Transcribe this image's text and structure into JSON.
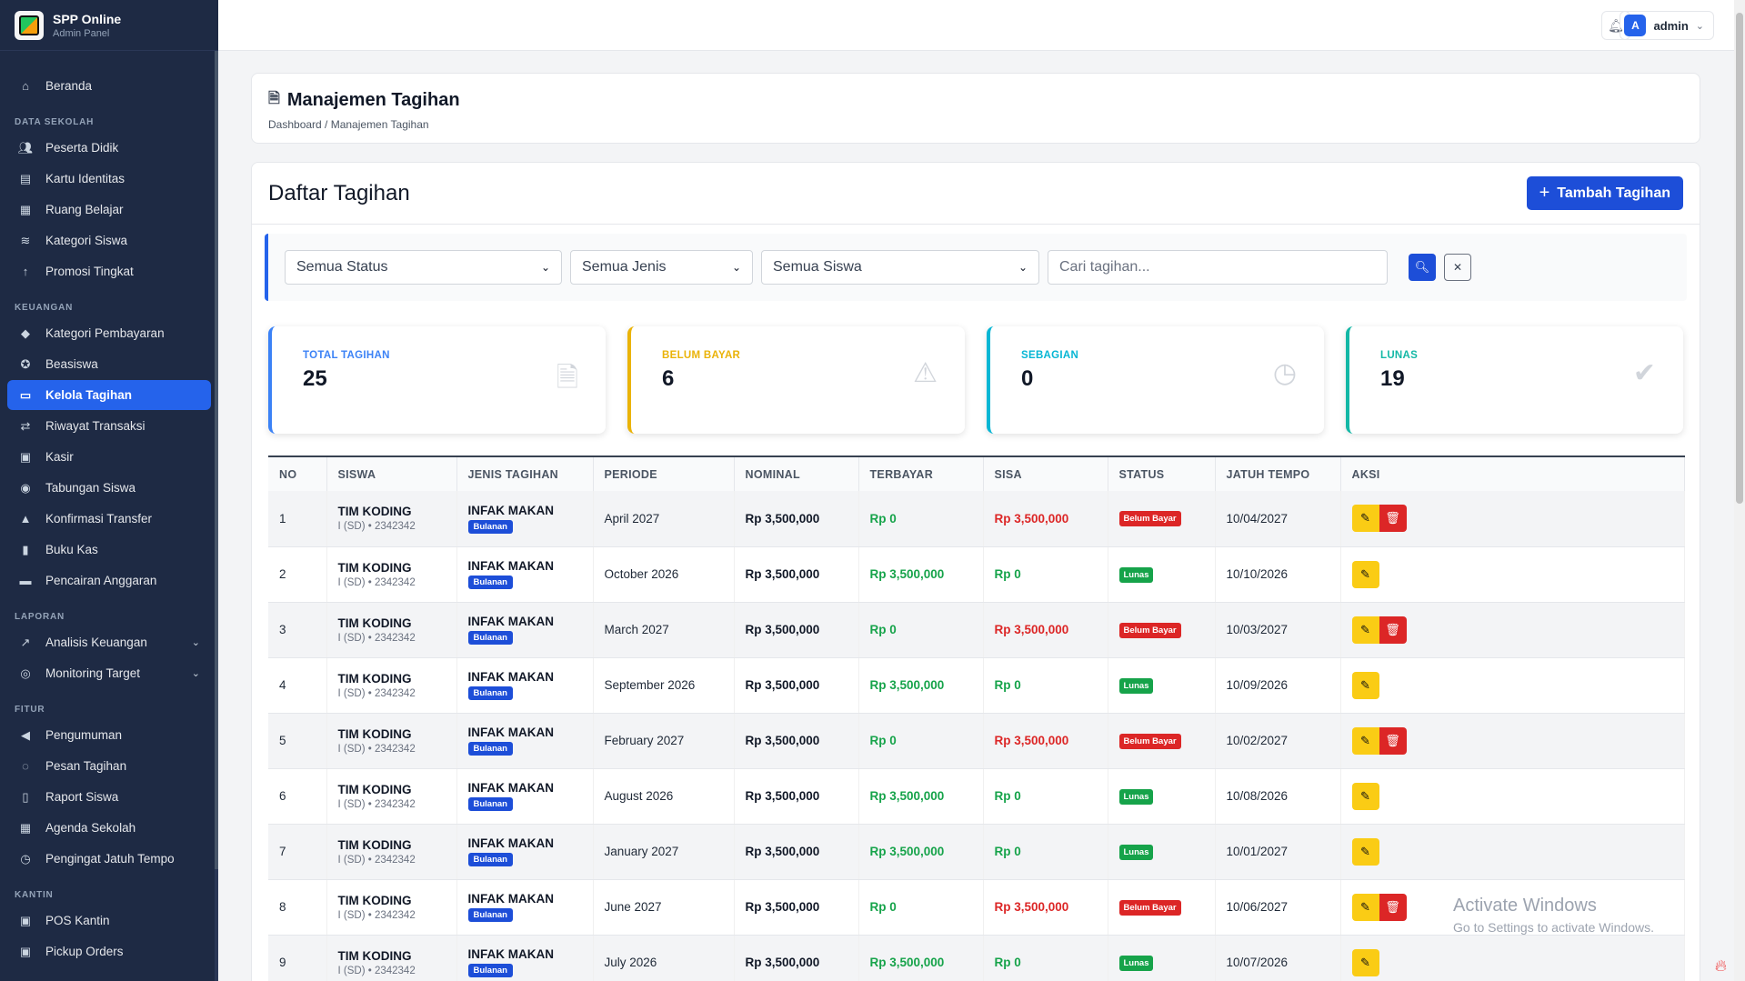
{
  "brand": {
    "title": "SPP Online",
    "subtitle": "Admin Panel"
  },
  "sidebar": {
    "home": {
      "label": "Beranda",
      "icon": "home-icon"
    },
    "sections": [
      {
        "title": "DATA SEKOLAH",
        "items": [
          {
            "label": "Peserta Didik",
            "icon": "users-icon"
          },
          {
            "label": "Kartu Identitas",
            "icon": "id-card-icon"
          },
          {
            "label": "Ruang Belajar",
            "icon": "building-icon"
          },
          {
            "label": "Kategori Siswa",
            "icon": "layers-icon"
          },
          {
            "label": "Promosi Tingkat",
            "icon": "arrow-up-icon"
          }
        ]
      },
      {
        "title": "KEUANGAN",
        "items": [
          {
            "label": "Kategori Pembayaran",
            "icon": "tag-icon"
          },
          {
            "label": "Beasiswa",
            "icon": "award-icon"
          },
          {
            "label": "Kelola Tagihan",
            "icon": "file-invoice-icon",
            "active": true
          },
          {
            "label": "Riwayat Transaksi",
            "icon": "exchange-icon"
          },
          {
            "label": "Kasir",
            "icon": "cash-register-icon"
          },
          {
            "label": "Tabungan Siswa",
            "icon": "piggy-bank-icon"
          },
          {
            "label": "Konfirmasi Transfer",
            "icon": "bell-icon"
          },
          {
            "label": "Buku Kas",
            "icon": "book-icon"
          },
          {
            "label": "Pencairan Anggaran",
            "icon": "wallet-icon"
          }
        ]
      },
      {
        "title": "LAPORAN",
        "items": [
          {
            "label": "Analisis Keuangan",
            "icon": "chart-line-icon",
            "expandable": true
          },
          {
            "label": "Monitoring Target",
            "icon": "target-icon",
            "expandable": true
          }
        ]
      },
      {
        "title": "FITUR",
        "items": [
          {
            "label": "Pengumuman",
            "icon": "megaphone-icon"
          },
          {
            "label": "Pesan Tagihan",
            "icon": "whatsapp-icon"
          },
          {
            "label": "Raport Siswa",
            "icon": "book-open-icon"
          },
          {
            "label": "Agenda Sekolah",
            "icon": "calendar-icon"
          },
          {
            "label": "Pengingat Jatuh Tempo",
            "icon": "clock-icon"
          }
        ]
      },
      {
        "title": "KANTIN",
        "items": [
          {
            "label": "POS Kantin",
            "icon": "cash-register-icon"
          },
          {
            "label": "Pickup Orders",
            "icon": "shopping-bag-icon"
          }
        ]
      }
    ]
  },
  "topbar": {
    "user": "admin",
    "avatar_letter": "A"
  },
  "page": {
    "title": "Manajemen Tagihan",
    "breadcrumb": "Dashboard / Manajemen Tagihan"
  },
  "list": {
    "title": "Daftar Tagihan",
    "add_button": "Tambah Tagihan"
  },
  "filters": {
    "status": "Semua Status",
    "jenis": "Semua Jenis",
    "siswa": "Semua Siswa",
    "search_placeholder": "Cari tagihan..."
  },
  "stats": [
    {
      "label": "TOTAL TAGIHAN",
      "value": "25",
      "color": "#3b82f6",
      "icon": "file-icon"
    },
    {
      "label": "BELUM BAYAR",
      "value": "6",
      "color": "#eab308",
      "icon": "warning-icon"
    },
    {
      "label": "SEBAGIAN",
      "value": "0",
      "color": "#06b6d4",
      "icon": "clock-icon"
    },
    {
      "label": "LUNAS",
      "value": "19",
      "color": "#14b8a6",
      "icon": "check-circle-icon"
    }
  ],
  "table": {
    "columns": [
      "NO",
      "SISWA",
      "JENIS TAGIHAN",
      "PERIODE",
      "NOMINAL",
      "TERBAYAR",
      "SISA",
      "STATUS",
      "JATUH TEMPO",
      "AKSI"
    ],
    "rows": [
      {
        "no": "1",
        "name": "TIM KODING",
        "sub": "I (SD) • 2342342",
        "jenis": "INFAK MAKAN",
        "tag": "Bulanan",
        "periode": "April 2027",
        "nominal": "Rp 3,500,000",
        "terbayar": "Rp 0",
        "sisa": "Rp 3,500,000",
        "status": "Belum Bayar",
        "tempo": "10/04/2027"
      },
      {
        "no": "2",
        "name": "TIM KODING",
        "sub": "I (SD) • 2342342",
        "jenis": "INFAK MAKAN",
        "tag": "Bulanan",
        "periode": "October 2026",
        "nominal": "Rp 3,500,000",
        "terbayar": "Rp 3,500,000",
        "sisa": "Rp 0",
        "status": "Lunas",
        "tempo": "10/10/2026"
      },
      {
        "no": "3",
        "name": "TIM KODING",
        "sub": "I (SD) • 2342342",
        "jenis": "INFAK MAKAN",
        "tag": "Bulanan",
        "periode": "March 2027",
        "nominal": "Rp 3,500,000",
        "terbayar": "Rp 0",
        "sisa": "Rp 3,500,000",
        "status": "Belum Bayar",
        "tempo": "10/03/2027"
      },
      {
        "no": "4",
        "name": "TIM KODING",
        "sub": "I (SD) • 2342342",
        "jenis": "INFAK MAKAN",
        "tag": "Bulanan",
        "periode": "September 2026",
        "nominal": "Rp 3,500,000",
        "terbayar": "Rp 3,500,000",
        "sisa": "Rp 0",
        "status": "Lunas",
        "tempo": "10/09/2026"
      },
      {
        "no": "5",
        "name": "TIM KODING",
        "sub": "I (SD) • 2342342",
        "jenis": "INFAK MAKAN",
        "tag": "Bulanan",
        "periode": "February 2027",
        "nominal": "Rp 3,500,000",
        "terbayar": "Rp 0",
        "sisa": "Rp 3,500,000",
        "status": "Belum Bayar",
        "tempo": "10/02/2027"
      },
      {
        "no": "6",
        "name": "TIM KODING",
        "sub": "I (SD) • 2342342",
        "jenis": "INFAK MAKAN",
        "tag": "Bulanan",
        "periode": "August 2026",
        "nominal": "Rp 3,500,000",
        "terbayar": "Rp 3,500,000",
        "sisa": "Rp 0",
        "status": "Lunas",
        "tempo": "10/08/2026"
      },
      {
        "no": "7",
        "name": "TIM KODING",
        "sub": "I (SD) • 2342342",
        "jenis": "INFAK MAKAN",
        "tag": "Bulanan",
        "periode": "January 2027",
        "nominal": "Rp 3,500,000",
        "terbayar": "Rp 3,500,000",
        "sisa": "Rp 0",
        "status": "Lunas",
        "tempo": "10/01/2027"
      },
      {
        "no": "8",
        "name": "TIM KODING",
        "sub": "I (SD) • 2342342",
        "jenis": "INFAK MAKAN",
        "tag": "Bulanan",
        "periode": "June 2027",
        "nominal": "Rp 3,500,000",
        "terbayar": "Rp 0",
        "sisa": "Rp 3,500,000",
        "status": "Belum Bayar",
        "tempo": "10/06/2027"
      },
      {
        "no": "9",
        "name": "TIM KODING",
        "sub": "I (SD) • 2342342",
        "jenis": "INFAK MAKAN",
        "tag": "Bulanan",
        "periode": "July 2026",
        "nominal": "Rp 3,500,000",
        "terbayar": "Rp 3,500,000",
        "sisa": "Rp 0",
        "status": "Lunas",
        "tempo": "10/07/2026"
      }
    ]
  },
  "watermark": {
    "title": "Activate Windows",
    "subtitle": "Go to Settings to activate Windows."
  }
}
